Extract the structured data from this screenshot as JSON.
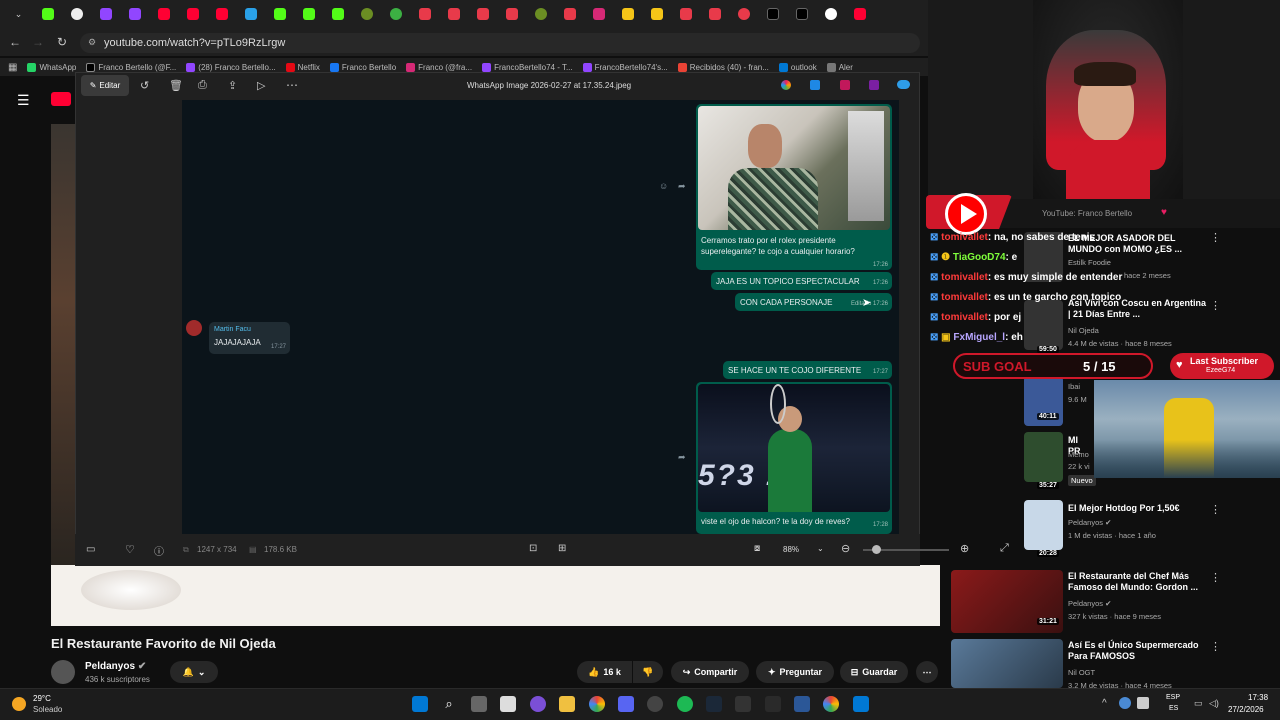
{
  "browser": {
    "url": "youtube.com/watch?v=pTLo9RzLrgw",
    "bookmarks": [
      "WhatsApp",
      "Franco Bertello (@F...",
      "(28) Franco Bertello...",
      "Netflix",
      "Franco Bertello",
      "Franco (@fra...",
      "FrancoBertello74 - T...",
      "FrancoBertello74's...",
      "Recibidos (40) - fran...",
      "outlook",
      "Aler"
    ]
  },
  "viewer": {
    "title": "WhatsApp Image 2026-02-27 at 17.35.24.jpeg",
    "edit_label": "Editar",
    "dimensions": "1247 x 734",
    "filesize": "178.6 KB",
    "zoom": "88%"
  },
  "chat": {
    "msg1_text": "Cerramos trato por el rolex presidente superelegante? te cojo a cualquier horario?",
    "msg1_time": "17:26",
    "msg2_text": "JAJA ES UN TOPICO ESPECTACULAR",
    "msg2_time": "17:26",
    "msg3_text": "CON CADA PERSONAJE",
    "msg3_time": "Editado 17:26",
    "in_name": "Martin Facu",
    "in_text": "JAJAJAJAJA",
    "in_time": "17:27",
    "msg4_text": "SE HACE UN TE COJO DIFERENTE",
    "msg4_time": "17:27",
    "msg5_text": "viste el ojo de halcon? te la doy de reves?",
    "msg5_time": "17:28",
    "photo2_caption": "5?3  15"
  },
  "video": {
    "title": "El Restaurante Favorito de Nil Ojeda",
    "channel": "Peldanyos",
    "subs": "436 k suscriptores",
    "likes": "16 k",
    "share": "Compartir",
    "ask": "Preguntar",
    "save": "Guardar"
  },
  "stream": {
    "yt_label": "YouTube: Franco Bertello",
    "chat": [
      {
        "user": "tomivallet",
        "msg": "na, no sabes de tenis",
        "color": "#ff3b3b"
      },
      {
        "user": "TiaGooD74",
        "msg": "e",
        "color": "#7fff3b"
      },
      {
        "user": "tomivallet",
        "msg": "es muy simple de entender",
        "color": "#ff3b3b"
      },
      {
        "user": "tomivallet",
        "msg": "es un te garcho con topico",
        "color": "#ff3b3b"
      },
      {
        "user": "tomivallet",
        "msg": "por ej",
        "color": "#ff3b3b"
      },
      {
        "user": "FxMiguel_l",
        "msg": "eh",
        "color": "#b8a6ff"
      }
    ],
    "subgoal_label": "SUB GOAL",
    "subgoal_value": "5 / 15",
    "lastsub_label": "Last Subscriber",
    "lastsub_name": "EzeeG74"
  },
  "recs": [
    {
      "title": "EL MEJOR ASADOR DEL MUNDO con MOMO ¿ES ...",
      "channel": "Estilk Foodie",
      "meta": "hace 2 meses",
      "duration": ""
    },
    {
      "title": "Así Viví con Coscu en Argentina | 21 Días Entre ...",
      "channel": "Nil Ojeda",
      "meta": "4.4 M de vistas · hace 8 meses",
      "duration": "59:50"
    },
    {
      "title": "",
      "channel": "Ibai",
      "meta": "9.6 M",
      "duration": "40:11"
    },
    {
      "title": "MI PR",
      "channel": "Memo",
      "meta": "22 k vi",
      "duration": "35:27",
      "badge": "Nuevo"
    },
    {
      "title": "El Mejor Hotdog Por 1,50€",
      "channel": "Peldanyos",
      "meta": "1 M de vistas · hace 1 año",
      "duration": "20:28"
    },
    {
      "title": "El Restaurante del Chef Más Famoso del Mundo: Gordon ...",
      "channel": "Peldanyos",
      "meta": "327 k vistas · hace 9 meses",
      "duration": "31:21"
    },
    {
      "title": "Así Es el Único Supermercado Para FAMOSOS",
      "channel": "Nil OGT",
      "meta": "3.2 M de vistas · hace 4 meses",
      "duration": ""
    }
  ],
  "taskbar": {
    "weather_temp": "29°C",
    "weather_desc": "Soleado",
    "lang1": "ESP",
    "lang2": "ES",
    "time": "17:38",
    "date": "27/2/2026"
  },
  "colors": {
    "accent_red": "#d0182a",
    "wa_out": "#005c4b",
    "wa_in": "#202c33"
  }
}
